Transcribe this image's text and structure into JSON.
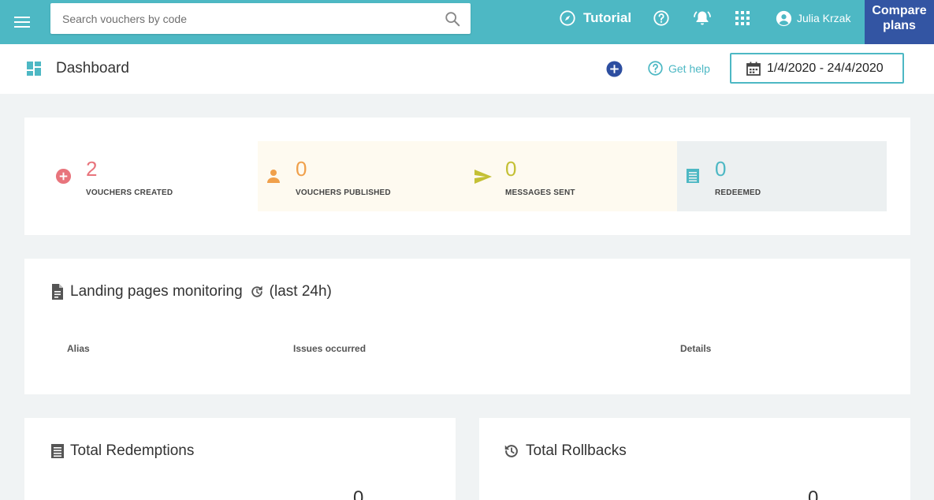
{
  "topbar": {
    "search_placeholder": "Search vouchers by code",
    "tutorial_label": "Tutorial",
    "user_name": "Julia Krzak",
    "compare_line1": "Compare",
    "compare_line2": "plans"
  },
  "header": {
    "title": "Dashboard",
    "get_help_label": "Get help",
    "date_range": "1/4/2020 - 24/4/2020"
  },
  "stats": [
    {
      "value": "2",
      "label": "VOUCHERS CREATED",
      "color": "#e8747c"
    },
    {
      "value": "0",
      "label": "VOUCHERS PUBLISHED",
      "color": "#f0a04b"
    },
    {
      "value": "0",
      "label": "MESSAGES SENT",
      "color": "#c4c035"
    },
    {
      "value": "0",
      "label": "REDEEMED",
      "color": "#4db8c4"
    }
  ],
  "monitoring": {
    "title": "Landing pages monitoring",
    "suffix": "(last 24h)",
    "columns": [
      "Alias",
      "Issues occurred",
      "Details"
    ]
  },
  "redemptions": {
    "title": "Total Redemptions",
    "value": "0"
  },
  "rollbacks": {
    "title": "Total Rollbacks",
    "value": "0"
  },
  "colors": {
    "accent": "#4db8c4",
    "compare_bg": "#3355a3",
    "published_bg": "#fefaf0",
    "redeemed_bg": "#ecf0f1"
  }
}
